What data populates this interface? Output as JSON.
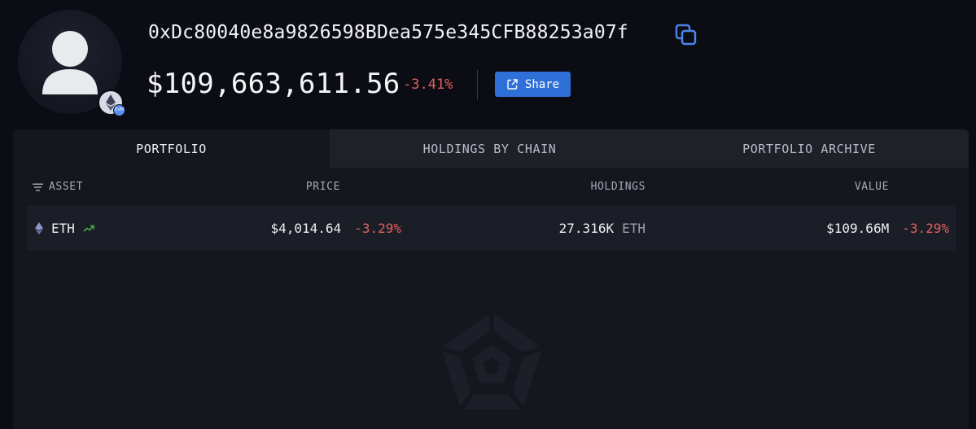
{
  "profile": {
    "address": "0xDc80040e8a9826598BDea575e345CFB88253a07f",
    "chain_badge_text": "EVM",
    "total_value": "$109,663,611.56",
    "total_change": "-3.41%",
    "share_label": "Share"
  },
  "tabs": [
    {
      "label": "PORTFOLIO",
      "active": true
    },
    {
      "label": "HOLDINGS BY CHAIN",
      "active": false
    },
    {
      "label": "PORTFOLIO ARCHIVE",
      "active": false
    }
  ],
  "table": {
    "columns": [
      "ASSET",
      "PRICE",
      "HOLDINGS",
      "VALUE"
    ],
    "rows": [
      {
        "asset": "ETH",
        "price": "$4,014.64",
        "price_change": "-3.29%",
        "holdings": "27.316K",
        "holdings_unit": "ETH",
        "value": "$109.66M",
        "value_change": "-3.29%"
      }
    ]
  },
  "colors": {
    "background": "#0c0d14",
    "panel": "#15171f",
    "accent": "#2f6fd8",
    "negative": "#e0605a",
    "positive": "#4caf50"
  },
  "icons": {
    "copy": "copy-icon",
    "share": "external-link-icon",
    "sort": "filter-lines-icon",
    "asset": "ethereum-icon",
    "trend": "trending-up-icon",
    "watermark": "arkham-logo"
  }
}
